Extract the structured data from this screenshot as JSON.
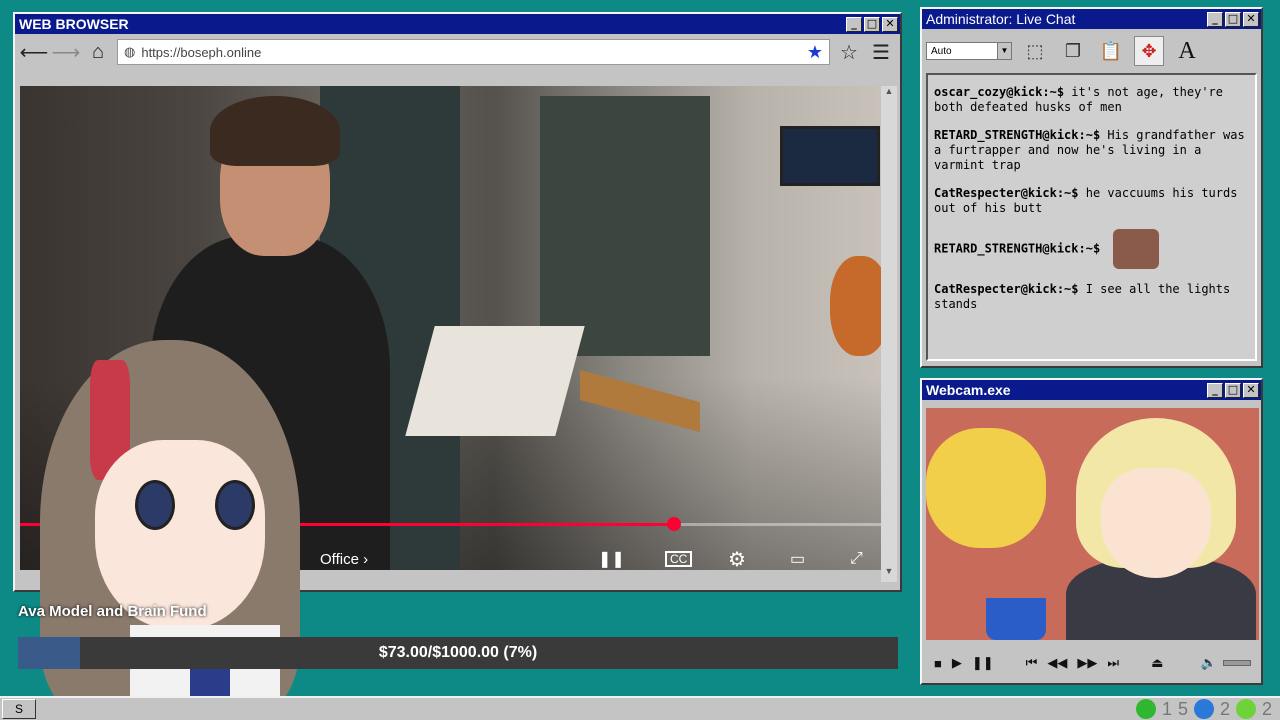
{
  "browser": {
    "title": "WEB BROWSER",
    "url": "https://boseph.online",
    "video": {
      "progress_fraction": 0.76,
      "office_label": "Office",
      "controls": [
        "pause-icon",
        "cc-icon",
        "settings-icon",
        "theater-icon",
        "fullscreen-icon"
      ]
    }
  },
  "fund": {
    "title": "Ava Model and Brain Fund",
    "amount_text": "$73.00/$1000.00 (7%)",
    "percent": 7
  },
  "chat": {
    "title": "Administrator: Live Chat",
    "font_dropdown": "Auto",
    "messages": [
      {
        "user": "oscar_cozy@kick:~$",
        "text": "it's not age, they're both defeated husks of men"
      },
      {
        "user": "RETARD_STRENGTH@kick:~$",
        "text": "His grandfather was a furtrapper and now he's living in a varmint trap"
      },
      {
        "user": "CatRespecter@kick:~$",
        "text": "he vaccuums his turds out of his butt"
      },
      {
        "user": "RETARD_STRENGTH@kick:~$",
        "text": "",
        "emote": true
      },
      {
        "user": "CatRespecter@kick:~$",
        "text": "I see all the lights stands"
      }
    ]
  },
  "webcam": {
    "title": "Webcam.exe"
  },
  "taskbar": {
    "start_label": "S",
    "tray_values": [
      "1",
      "5",
      "2",
      "2"
    ]
  },
  "colors": {
    "desktop": "#0e8a86",
    "titlebar": "#0a1a8c",
    "progress": "#ff0033"
  }
}
